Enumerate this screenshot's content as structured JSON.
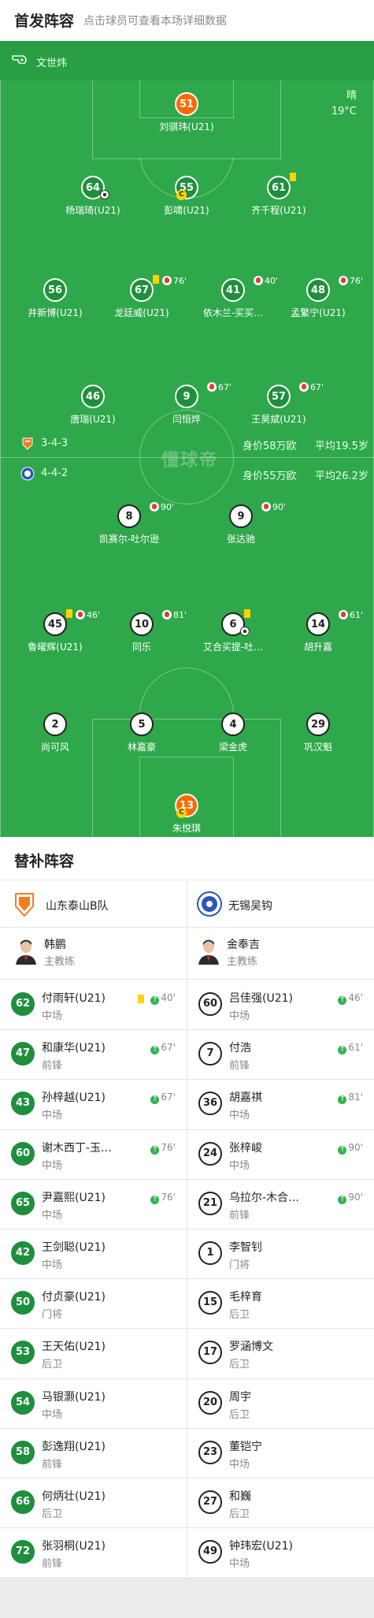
{
  "header": {
    "title": "首发阵容",
    "hint": "点击球员可查看本场详细数据"
  },
  "referee": {
    "name": "文世炜",
    "icon": "whistle-icon"
  },
  "weather": {
    "condition": "晴",
    "temperature": "19°C"
  },
  "watermark": "懂球帝",
  "home_team": {
    "name": "山东泰山B队",
    "formation": "3-4-3",
    "market_value": "身价58万欧",
    "avg_age": "平均19.5岁",
    "coach_name": "韩鹏",
    "coach_role": "主教练",
    "color": "#1f8f3e",
    "lineup": [
      {
        "num": "51",
        "name": "刘骐玮(U21)",
        "gk": true
      },
      {
        "num": "64",
        "name": "杨瑞琦(U21)",
        "goal": true
      },
      {
        "num": "55",
        "name": "彭啸(U21)",
        "captain": true
      },
      {
        "num": "61",
        "name": "齐千程(U21)",
        "yellow": true
      },
      {
        "num": "56",
        "name": "井新博(U21)"
      },
      {
        "num": "67",
        "name": "龙廷威(U21)",
        "yellow": true,
        "sub_min": "76'"
      },
      {
        "num": "41",
        "name": "依木兰-买买…",
        "sub_min": "40'"
      },
      {
        "num": "48",
        "name": "孟繁宁(U21)",
        "sub_min": "76'"
      },
      {
        "num": "46",
        "name": "唐瑞(U21)"
      },
      {
        "num": "9",
        "name": "闫恒烨",
        "sub_min": "67'"
      },
      {
        "num": "57",
        "name": "王昊斌(U21)",
        "sub_min": "67'"
      }
    ]
  },
  "away_team": {
    "name": "无锡吴钩",
    "formation": "4-4-2",
    "market_value": "身价55万欧",
    "avg_age": "平均26.2岁",
    "coach_name": "金奉吉",
    "coach_role": "主教练",
    "lineup": [
      {
        "num": "8",
        "name": "凯赛尔-吐尔逊",
        "sub_min": "90'"
      },
      {
        "num": "9",
        "name": "张达驰",
        "sub_min": "90'"
      },
      {
        "num": "45",
        "name": "鲁曜辉(U21)",
        "yellow": true,
        "sub_min": "46'"
      },
      {
        "num": "10",
        "name": "同乐",
        "sub_min": "81'"
      },
      {
        "num": "6",
        "name": "艾合买提-吐…",
        "yellow": true,
        "goal": true
      },
      {
        "num": "14",
        "name": "胡升嘉",
        "sub_min": "61'"
      },
      {
        "num": "2",
        "name": "尚可风"
      },
      {
        "num": "5",
        "name": "林嘉豪"
      },
      {
        "num": "4",
        "name": "梁金虎"
      },
      {
        "num": "29",
        "name": "巩汉魁"
      },
      {
        "num": "13",
        "name": "朱悦琪",
        "gk": true,
        "captain": true
      }
    ]
  },
  "subs_section": {
    "title": "替补阵容",
    "home": [
      {
        "num": "62",
        "name": "付雨轩(U21)",
        "pos": "中场",
        "in": "40'",
        "yellow": true
      },
      {
        "num": "47",
        "name": "和康华(U21)",
        "pos": "前锋",
        "in": "67'"
      },
      {
        "num": "43",
        "name": "孙梓越(U21)",
        "pos": "中场",
        "in": "67'"
      },
      {
        "num": "60",
        "name": "谢木西丁-玉…",
        "pos": "中场",
        "in": "76'"
      },
      {
        "num": "65",
        "name": "尹嘉熙(U21)",
        "pos": "中场",
        "in": "76'"
      },
      {
        "num": "42",
        "name": "王剑聪(U21)",
        "pos": "中场"
      },
      {
        "num": "50",
        "name": "付贞豪(U21)",
        "pos": "门将"
      },
      {
        "num": "53",
        "name": "王天佑(U21)",
        "pos": "后卫"
      },
      {
        "num": "54",
        "name": "马银灏(U21)",
        "pos": "中场"
      },
      {
        "num": "58",
        "name": "彭逸翔(U21)",
        "pos": "前锋"
      },
      {
        "num": "66",
        "name": "何炳壮(U21)",
        "pos": "后卫"
      },
      {
        "num": "72",
        "name": "张羽桐(U21)",
        "pos": "前锋"
      }
    ],
    "away": [
      {
        "num": "60",
        "name": "吕佳强(U21)",
        "pos": "中场",
        "in": "46'"
      },
      {
        "num": "7",
        "name": "付浩",
        "pos": "前锋",
        "in": "61'"
      },
      {
        "num": "36",
        "name": "胡嘉祺",
        "pos": "中场",
        "in": "81'"
      },
      {
        "num": "24",
        "name": "张梓峻",
        "pos": "中场",
        "in": "90'"
      },
      {
        "num": "21",
        "name": "乌拉尔-木合…",
        "pos": "前锋",
        "in": "90'"
      },
      {
        "num": "1",
        "name": "李智钊",
        "pos": "门将"
      },
      {
        "num": "15",
        "name": "毛梓育",
        "pos": "后卫"
      },
      {
        "num": "17",
        "name": "罗涵博文",
        "pos": "后卫"
      },
      {
        "num": "20",
        "name": "周宇",
        "pos": "后卫"
      },
      {
        "num": "23",
        "name": "董铠宁",
        "pos": "中场"
      },
      {
        "num": "27",
        "name": "和巍",
        "pos": "后卫"
      },
      {
        "num": "49",
        "name": "钟玮宏(U21)",
        "pos": "中场"
      }
    ]
  }
}
